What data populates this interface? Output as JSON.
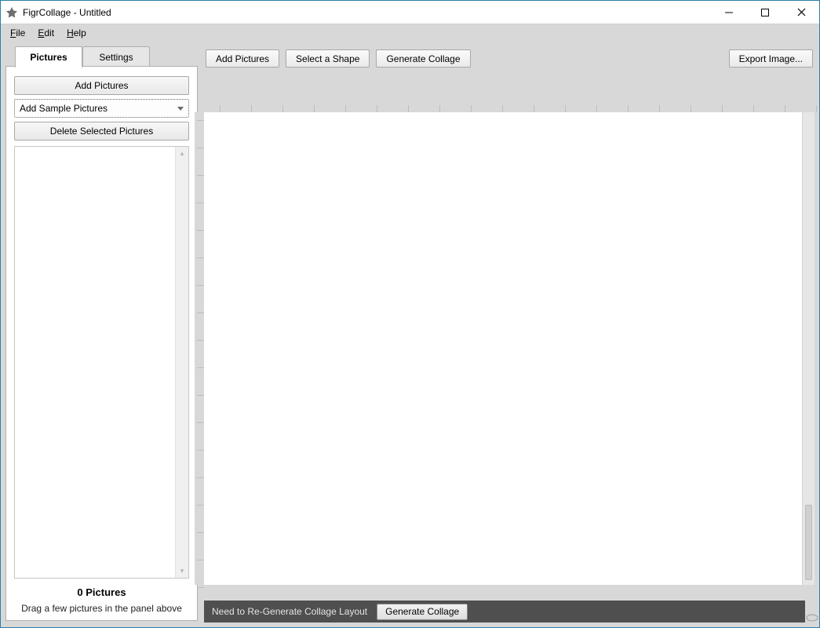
{
  "window": {
    "title": "FigrCollage - Untitled"
  },
  "menu": {
    "file": "File",
    "edit": "Edit",
    "help": "Help"
  },
  "sidebar": {
    "tabs": {
      "pictures": "Pictures",
      "settings": "Settings"
    },
    "buttons": {
      "add_pictures": "Add Pictures",
      "add_sample": "Add Sample Pictures",
      "delete_selected": "Delete Selected Pictures"
    },
    "footer": {
      "count_label": "0 Pictures",
      "hint": "Drag a few pictures in the panel above"
    }
  },
  "toolbar": {
    "add_pictures": "Add Pictures",
    "select_shape": "Select a Shape",
    "generate_collage": "Generate Collage",
    "export_image": "Export Image..."
  },
  "status": {
    "message": "Need to Re-Generate Collage Layout",
    "generate_collage": "Generate Collage"
  }
}
